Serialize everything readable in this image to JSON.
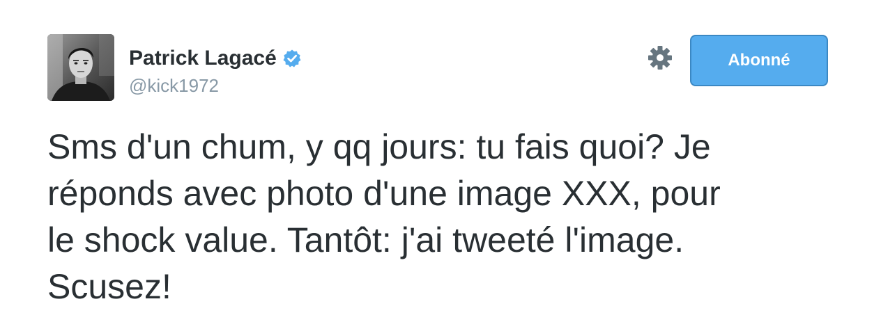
{
  "tweet": {
    "author": {
      "name": "Patrick Lagacé",
      "handle": "@kick1972",
      "verified": true
    },
    "follow_button_label": "Abonné",
    "text_lines": [
      "Sms d'un chum, y qq jours: tu fais quoi? Je",
      "réponds avec photo d'une image XXX, pour",
      "le shock value. Tantôt: j'ai tweeté l'image.",
      "Scusez!"
    ]
  },
  "colors": {
    "button_bg": "#55acee",
    "button_border": "#3b88c3",
    "verified_badge": "#55acee",
    "handle": "#8899a6",
    "text": "#292f33"
  },
  "icons": {
    "settings": "gear-icon",
    "verified": "verified-badge-icon"
  }
}
